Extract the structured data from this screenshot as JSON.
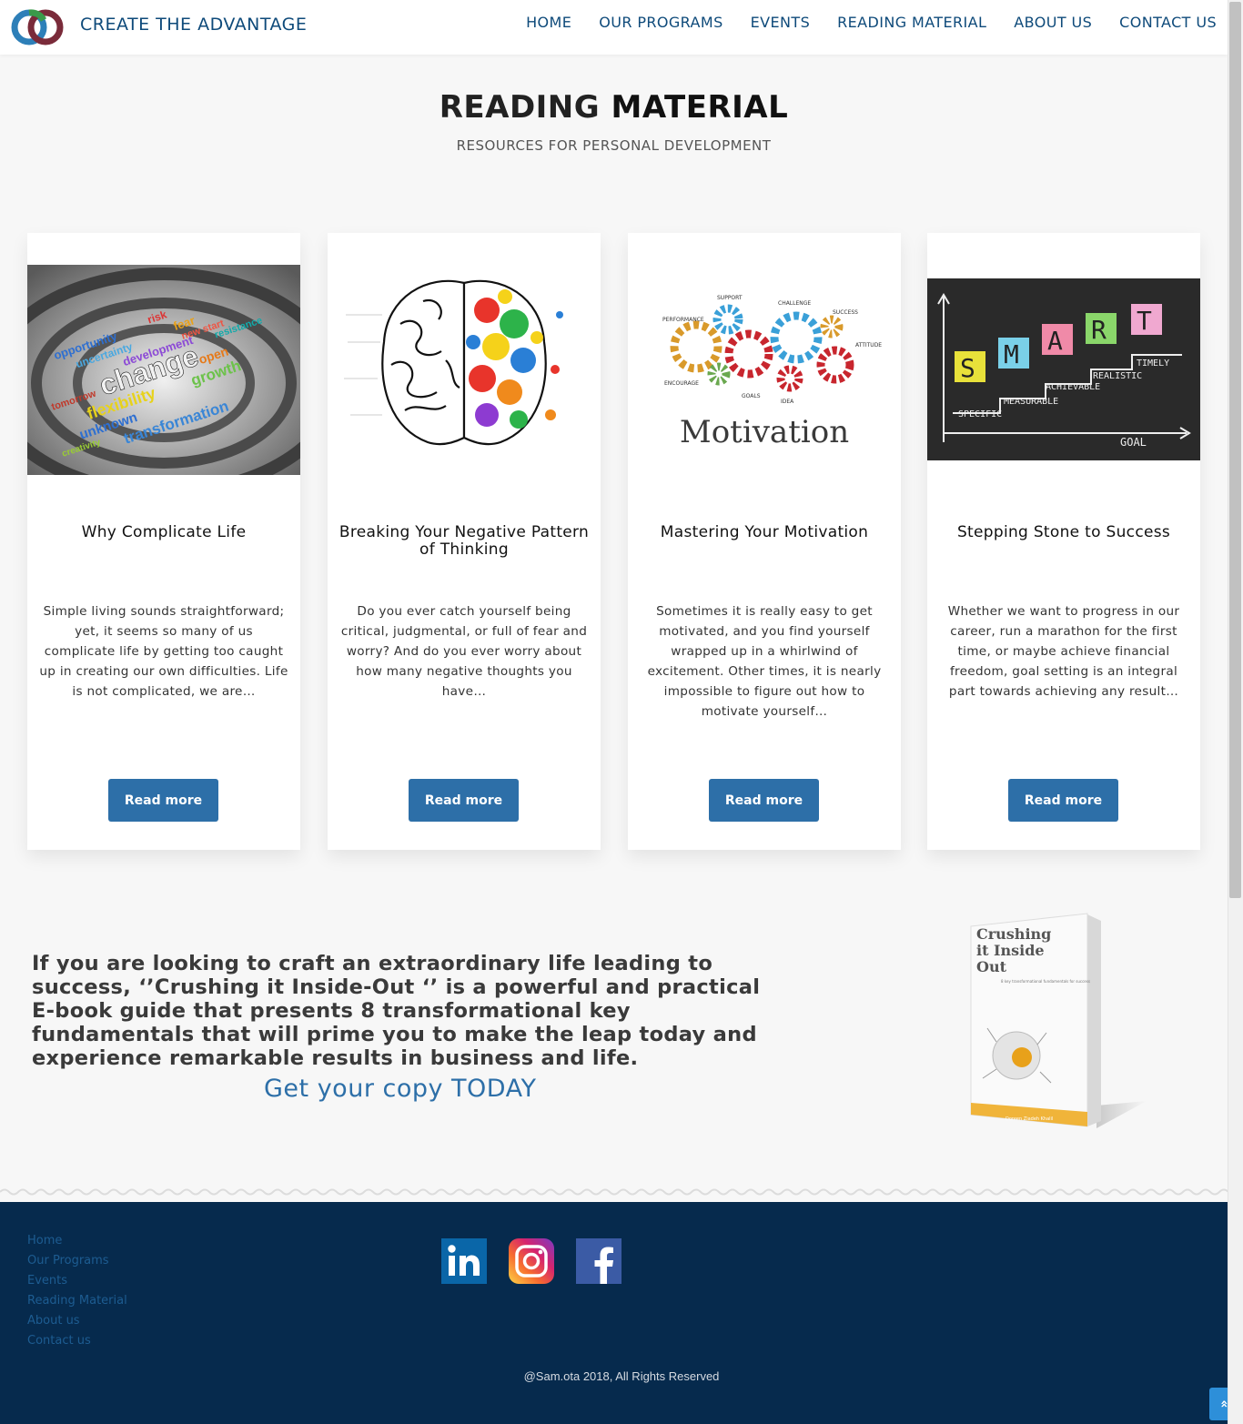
{
  "header": {
    "brand": "CREATE THE ADVANTAGE",
    "nav": [
      "HOME",
      "OUR PROGRAMS",
      "EVENTS",
      "READING MATERIAL",
      "ABOUT US",
      "CONTACT US"
    ]
  },
  "page": {
    "title_part1": "READING",
    "title_part2": "MATERIAL",
    "subtitle": "RESOURCES FOR PERSONAL DEVELOPMENT"
  },
  "cards": [
    {
      "title": "Why Complicate Life",
      "text": "Simple living sounds straightforward; yet, it seems so many of us complicate life by getting too caught up in creating our own difficulties. Life is not complicated, we are…",
      "button": "Read more"
    },
    {
      "title": "Breaking Your Negative Pattern of Thinking",
      "text": "Do you ever catch yourself being critical, judgmental, or full of fear and worry? And do you ever worry about how many negative thoughts you have…",
      "button": "Read more"
    },
    {
      "title": "Mastering Your Motivation",
      "text": "Sometimes it is really easy to get motivated, and you find yourself wrapped up in a whirlwind of excitement. Other times, it is nearly impossible to figure out how to motivate yourself…",
      "button": "Read more"
    },
    {
      "title": "Stepping Stone to Success",
      "text": "Whether we want to progress in our career, run a marathon for the first time, or maybe achieve financial freedom, goal setting is an integral part towards achieving any result…",
      "button": "Read more"
    }
  ],
  "card_images": {
    "change_words": [
      "change",
      "flexibility",
      "growth",
      "transformation",
      "unknown",
      "uncertainty",
      "opportunity",
      "development",
      "open",
      "risk",
      "fear",
      "creativity",
      "tomorrow",
      "resistance",
      "new start"
    ],
    "gear_labels": [
      "PERFORMANCE",
      "SUPPORT",
      "CHALLENGE",
      "SUCCESS",
      "ATTITUDE",
      "ENCOURAGE",
      "GOALS",
      "IDEA"
    ],
    "motivation_word": "Motivation",
    "smart_letters": [
      "S",
      "M",
      "A",
      "R",
      "T"
    ],
    "smart_steps": [
      "SPECIFIC",
      "MEASURABLE",
      "ACHIEVABLE",
      "REALISTIC",
      "TIMELY"
    ],
    "smart_goal": "GOAL"
  },
  "promo": {
    "text": "If you are looking to craft an extraordinary life leading to success, ‘’Crushing it Inside-Out ‘’ is a powerful and practical E-book guide that presents 8 transformational key fundamentals that will prime you to make the leap today and experience remarkable results in business and life.",
    "cta": "Get your copy TODAY",
    "book_title_lines": [
      "Crushing",
      "it Inside",
      "Out"
    ],
    "book_subtitle": "8 key transformational fundamentals for success",
    "book_author": "Doreen Ziadeh Khalil"
  },
  "footer": {
    "links": [
      "Home",
      "Our Programs",
      "Events",
      "Reading Material",
      "About us",
      "Contact us"
    ],
    "social": [
      "linkedin-icon",
      "instagram-icon",
      "facebook-icon"
    ],
    "copyright": "@Sam.ota 2018,  All Rights Reserved",
    "to_top": "»"
  },
  "colors": {
    "brand": "#0e4a7a",
    "button": "#2d6fa8",
    "footer_bg": "#062a4d",
    "footer_link": "#1d5c91"
  }
}
